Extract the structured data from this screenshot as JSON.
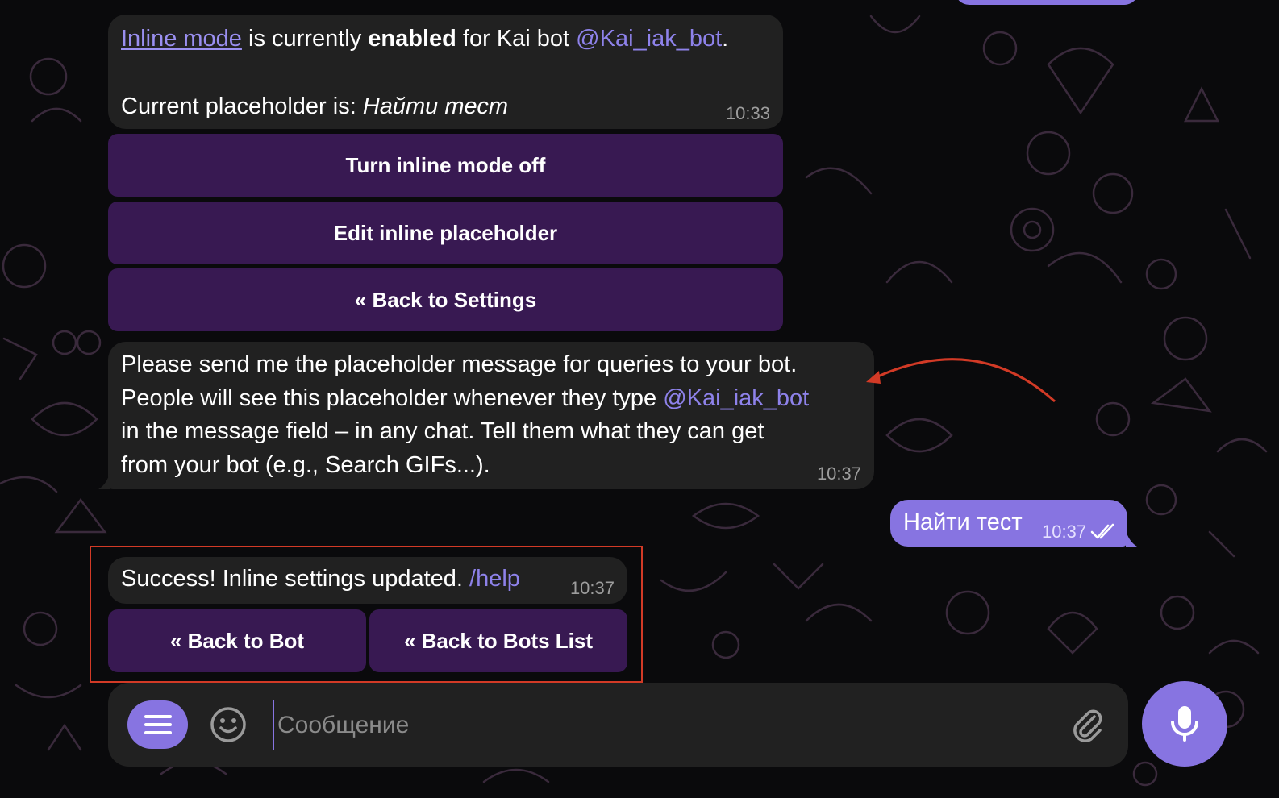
{
  "colors": {
    "accent": "#8774e1",
    "incoming_bubble": "#212121",
    "keyboard_button": "#4b206e",
    "link": "#8e82ea",
    "annotation_red": "#d23a26"
  },
  "top_message": {
    "inline_mode_link": "Inline mode",
    "text_part1": " is currently ",
    "text_bold": "enabled",
    "text_part2": " for Kai bot ",
    "bot_mention": "@Kai_iak_bot",
    "period": ".",
    "placeholder_label": "Current placeholder is: ",
    "placeholder_value": "Найти тест",
    "time": "10:33"
  },
  "keyboard1": {
    "btn_turn_off": "Turn inline mode off",
    "btn_edit": "Edit inline placeholder",
    "btn_back_settings": "« Back to Settings"
  },
  "prompt_message": {
    "line1": "Please send me the placeholder message for queries to your bot.",
    "line2_prefix": "People will see this placeholder whenever they type ",
    "line2_mention": "@Kai_iak_bot",
    "line3": "in the message field – in any chat. Tell them what they can get",
    "line4": "from your bot (e.g., Search GIFs...).",
    "time": "10:37"
  },
  "outgoing_message": {
    "text": "Найти тест",
    "time": "10:37",
    "status_icon": "double-check-icon"
  },
  "success_message": {
    "text": "Success! Inline settings updated. ",
    "command": "/help",
    "time": "10:37"
  },
  "keyboard2": {
    "btn_back_bot": "« Back to Bot",
    "btn_back_list": "« Back to Bots List"
  },
  "composer": {
    "placeholder": "Сообщение",
    "menu_icon": "menu-icon",
    "emoji_icon": "emoji-icon",
    "attach_icon": "paperclip-icon",
    "mic_icon": "microphone-icon"
  }
}
